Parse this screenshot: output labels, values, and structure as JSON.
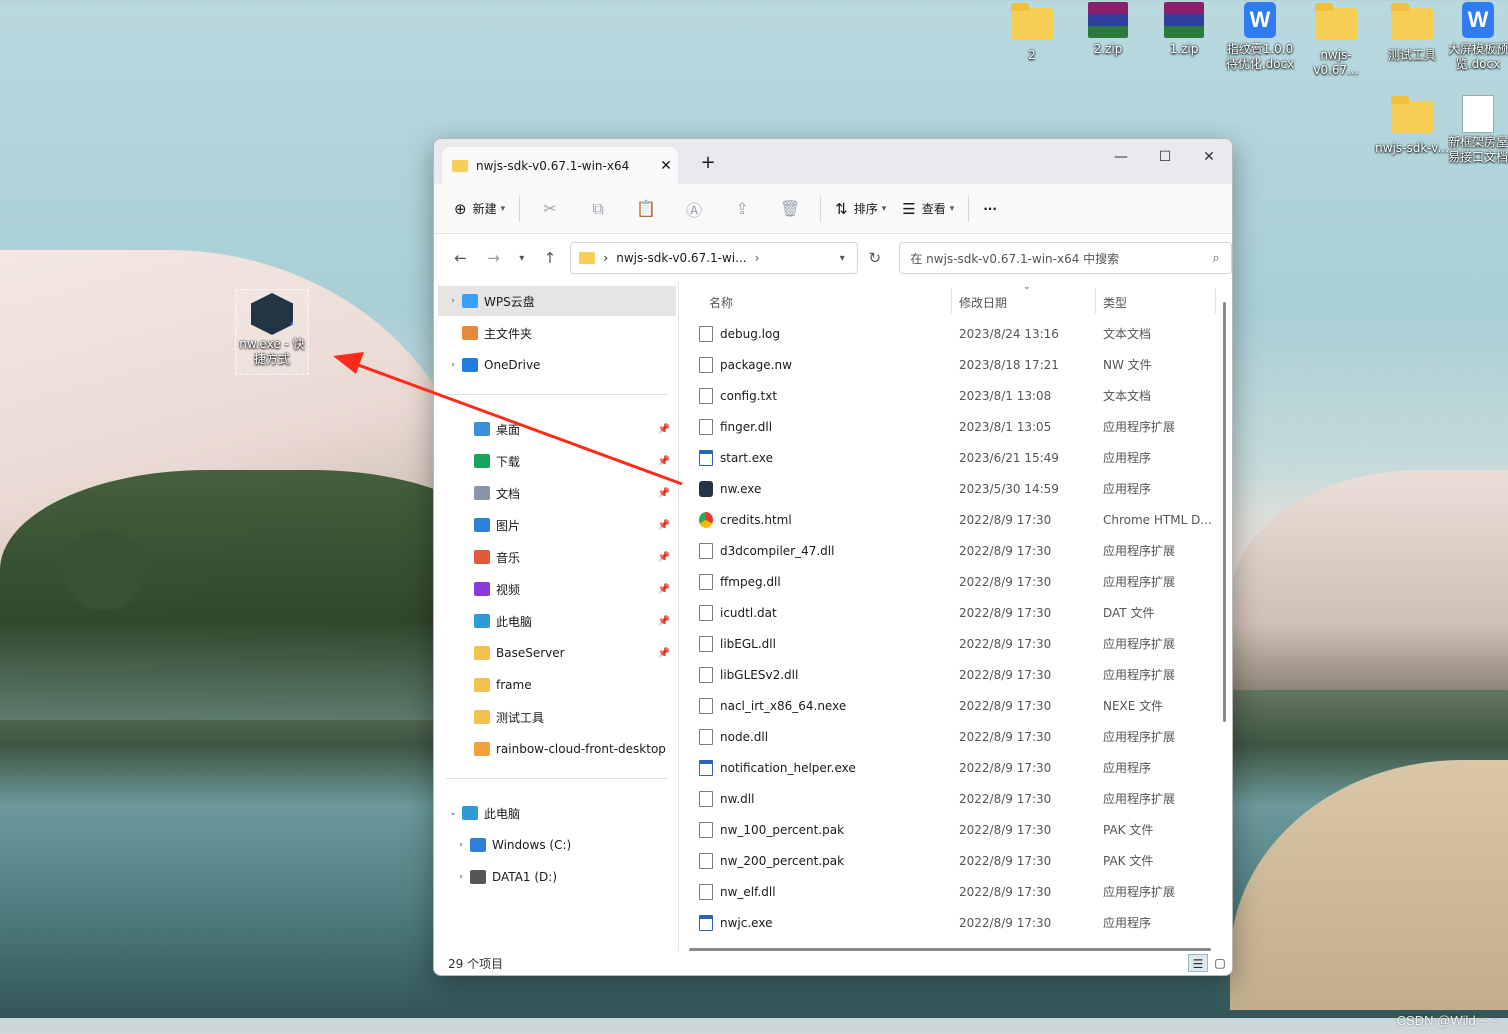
{
  "desktop": {
    "icons": [
      {
        "label": "2",
        "kind": "folder"
      },
      {
        "label": "2.zip",
        "kind": "rar"
      },
      {
        "label": "1.zip",
        "kind": "rar"
      },
      {
        "label": "指纹賣1.0.0待优化.docx",
        "kind": "wps"
      },
      {
        "label": "nwjs-v0.67...",
        "kind": "folder"
      },
      {
        "label": "测试工具",
        "kind": "folder"
      },
      {
        "label": "大屏模板预览.docx",
        "kind": "wps"
      },
      {
        "label": "nwjs-sdk-v...",
        "kind": "folder"
      },
      {
        "label": "新框架房屋易接口文档",
        "kind": "doc"
      }
    ],
    "shortcut_label": "nw.exe - 快捷方式",
    "watermark": "CSDN @Wild ~ ~"
  },
  "window": {
    "tab_title": "nwjs-sdk-v0.67.1-win-x64",
    "toolbar": {
      "new_label": "新建",
      "sort_label": "排序",
      "view_label": "查看",
      "more_label": "···"
    },
    "address": {
      "path_text": "nwjs-sdk-v0.67.1-wi...",
      "search_placeholder": "在 nwjs-sdk-v0.67.1-win-x64 中搜索"
    },
    "sidebar": [
      {
        "label": "WPS云盘",
        "icon": "cloud-icon",
        "expandable": true,
        "selected": true,
        "color": "#3aa0ff"
      },
      {
        "label": "主文件夹",
        "icon": "home-icon",
        "expandable": false,
        "color": "#e8883a"
      },
      {
        "label": "OneDrive",
        "icon": "onedrive-icon",
        "expandable": true,
        "color": "#1f7ee0"
      },
      {
        "label": "桌面",
        "icon": "desktop-icon",
        "pinned": true,
        "color": "#3a8fd8"
      },
      {
        "label": "下载",
        "icon": "download-icon",
        "pinned": true,
        "color": "#1aa35a"
      },
      {
        "label": "文档",
        "icon": "document-icon",
        "pinned": true,
        "color": "#8a95a5"
      },
      {
        "label": "图片",
        "icon": "pictures-icon",
        "pinned": true,
        "color": "#2f7fd8"
      },
      {
        "label": "音乐",
        "icon": "music-icon",
        "pinned": true,
        "color": "#e05a3a"
      },
      {
        "label": "视频",
        "icon": "videos-icon",
        "pinned": true,
        "color": "#8a3ad8"
      },
      {
        "label": "此电脑",
        "icon": "computer-icon",
        "pinned": true,
        "color": "#2f9ad8"
      },
      {
        "label": "BaseServer",
        "icon": "folder-icon",
        "pinned": true,
        "color": "#f2c24a"
      },
      {
        "label": "frame",
        "icon": "folder-icon",
        "color": "#f2c24a"
      },
      {
        "label": "测试工具",
        "icon": "folder-icon",
        "color": "#f2c24a"
      },
      {
        "label": "rainbow-cloud-front-desktop",
        "icon": "folder-warning-icon",
        "color": "#f2a23a"
      },
      {
        "label": "此电脑",
        "icon": "computer-icon",
        "expanded": true,
        "color": "#2f9ad8"
      },
      {
        "label": "Windows (C:)",
        "icon": "drive-c-icon",
        "expandable": true,
        "color": "#2f7fd8"
      },
      {
        "label": "DATA1 (D:)",
        "icon": "drive-d-icon",
        "expandable": true,
        "color": "#555555"
      }
    ],
    "columns": {
      "name": "名称",
      "modified": "修改日期",
      "type": "类型"
    },
    "files": [
      {
        "name": "debug.log",
        "date": "2023/8/24 13:16",
        "type": "文本文档",
        "icon": "text"
      },
      {
        "name": "package.nw",
        "date": "2023/8/18 17:21",
        "type": "NW 文件",
        "icon": "file"
      },
      {
        "name": "config.txt",
        "date": "2023/8/1 13:08",
        "type": "文本文档",
        "icon": "text"
      },
      {
        "name": "finger.dll",
        "date": "2023/8/1 13:05",
        "type": "应用程序扩展",
        "icon": "file"
      },
      {
        "name": "start.exe",
        "date": "2023/6/21 15:49",
        "type": "应用程序",
        "icon": "exe"
      },
      {
        "name": "nw.exe",
        "date": "2023/5/30 14:59",
        "type": "应用程序",
        "icon": "nw"
      },
      {
        "name": "credits.html",
        "date": "2022/8/9 17:30",
        "type": "Chrome HTML D...",
        "icon": "chrome"
      },
      {
        "name": "d3dcompiler_47.dll",
        "date": "2022/8/9 17:30",
        "type": "应用程序扩展",
        "icon": "file"
      },
      {
        "name": "ffmpeg.dll",
        "date": "2022/8/9 17:30",
        "type": "应用程序扩展",
        "icon": "file"
      },
      {
        "name": "icudtl.dat",
        "date": "2022/8/9 17:30",
        "type": "DAT 文件",
        "icon": "file"
      },
      {
        "name": "libEGL.dll",
        "date": "2022/8/9 17:30",
        "type": "应用程序扩展",
        "icon": "file"
      },
      {
        "name": "libGLESv2.dll",
        "date": "2022/8/9 17:30",
        "type": "应用程序扩展",
        "icon": "file"
      },
      {
        "name": "nacl_irt_x86_64.nexe",
        "date": "2022/8/9 17:30",
        "type": "NEXE 文件",
        "icon": "file"
      },
      {
        "name": "node.dll",
        "date": "2022/8/9 17:30",
        "type": "应用程序扩展",
        "icon": "file"
      },
      {
        "name": "notification_helper.exe",
        "date": "2022/8/9 17:30",
        "type": "应用程序",
        "icon": "exe"
      },
      {
        "name": "nw.dll",
        "date": "2022/8/9 17:30",
        "type": "应用程序扩展",
        "icon": "file"
      },
      {
        "name": "nw_100_percent.pak",
        "date": "2022/8/9 17:30",
        "type": "PAK 文件",
        "icon": "file"
      },
      {
        "name": "nw_200_percent.pak",
        "date": "2022/8/9 17:30",
        "type": "PAK 文件",
        "icon": "file"
      },
      {
        "name": "nw_elf.dll",
        "date": "2022/8/9 17:30",
        "type": "应用程序扩展",
        "icon": "file"
      },
      {
        "name": "nwjc.exe",
        "date": "2022/8/9 17:30",
        "type": "应用程序",
        "icon": "exe"
      }
    ],
    "status": "29 个项目"
  }
}
